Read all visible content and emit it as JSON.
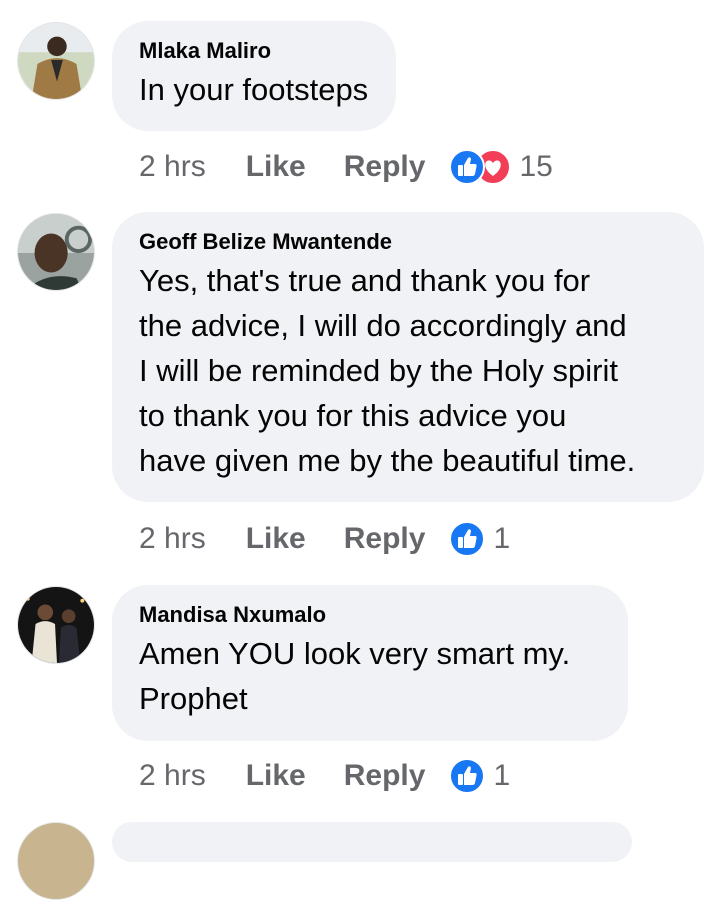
{
  "comments": [
    {
      "author": "Mlaka Maliro",
      "text": "In your footsteps",
      "time": "2 hrs",
      "like_label": "Like",
      "reply_label": "Reply",
      "reactions": [
        "like-icon",
        "love-icon"
      ],
      "reaction_count": "15"
    },
    {
      "author": "Geoff Belize Mwantende",
      "text": "Yes, that's true and thank you for\nthe advice, I will do accordingly and\nI will be reminded by the Holy spirit\nto thank you for this advice you\nhave given me by the beautiful time.",
      "time": "2 hrs",
      "like_label": "Like",
      "reply_label": "Reply",
      "reactions": [
        "like-icon"
      ],
      "reaction_count": "1"
    },
    {
      "author": "Mandisa Nxumalo",
      "text": "Amen YOU look very smart my.\nProphet",
      "time": "2 hrs",
      "like_label": "Like",
      "reply_label": "Reply",
      "reactions": [
        "like-icon"
      ],
      "reaction_count": "1"
    }
  ],
  "colors": {
    "bubble": "#f0f2f5",
    "secondary_text": "#65676b",
    "like_blue": "#1877f2",
    "love_red": "#f33e58"
  }
}
